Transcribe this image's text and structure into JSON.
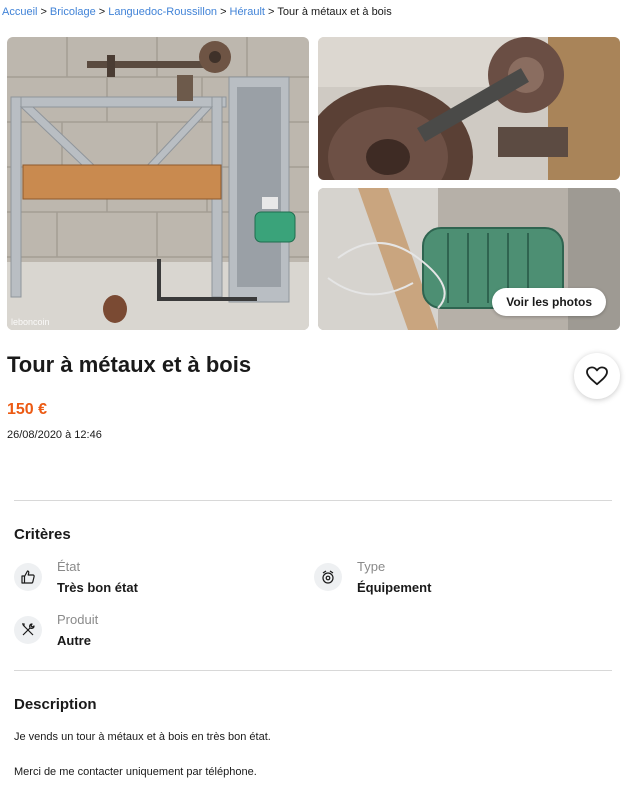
{
  "breadcrumb": {
    "items": [
      "Accueil",
      "Bricolage",
      "Languedoc-Roussillon",
      "Hérault"
    ],
    "current": "Tour à métaux et à bois",
    "separator": ">"
  },
  "gallery": {
    "watermark": "leboncoin",
    "view_photos_label": "Voir les photos"
  },
  "listing": {
    "title": "Tour à métaux et à bois",
    "price": "150 €",
    "date": "26/08/2020 à 12:46"
  },
  "criteria": {
    "heading": "Critères",
    "items": [
      {
        "label": "État",
        "value": "Très bon état",
        "icon": "thumbs-up-icon"
      },
      {
        "label": "Type",
        "value": "Équipement",
        "icon": "equipment-icon"
      },
      {
        "label": "Produit",
        "value": "Autre",
        "icon": "tools-icon"
      }
    ]
  },
  "description": {
    "heading": "Description",
    "lines": [
      "Je vends un tour à métaux et à bois en très bon état.",
      "Merci de me contacter uniquement par téléphone."
    ]
  },
  "colors": {
    "price": "#ec5a13",
    "link": "#4183d7",
    "divider": "#d8d8d8"
  }
}
